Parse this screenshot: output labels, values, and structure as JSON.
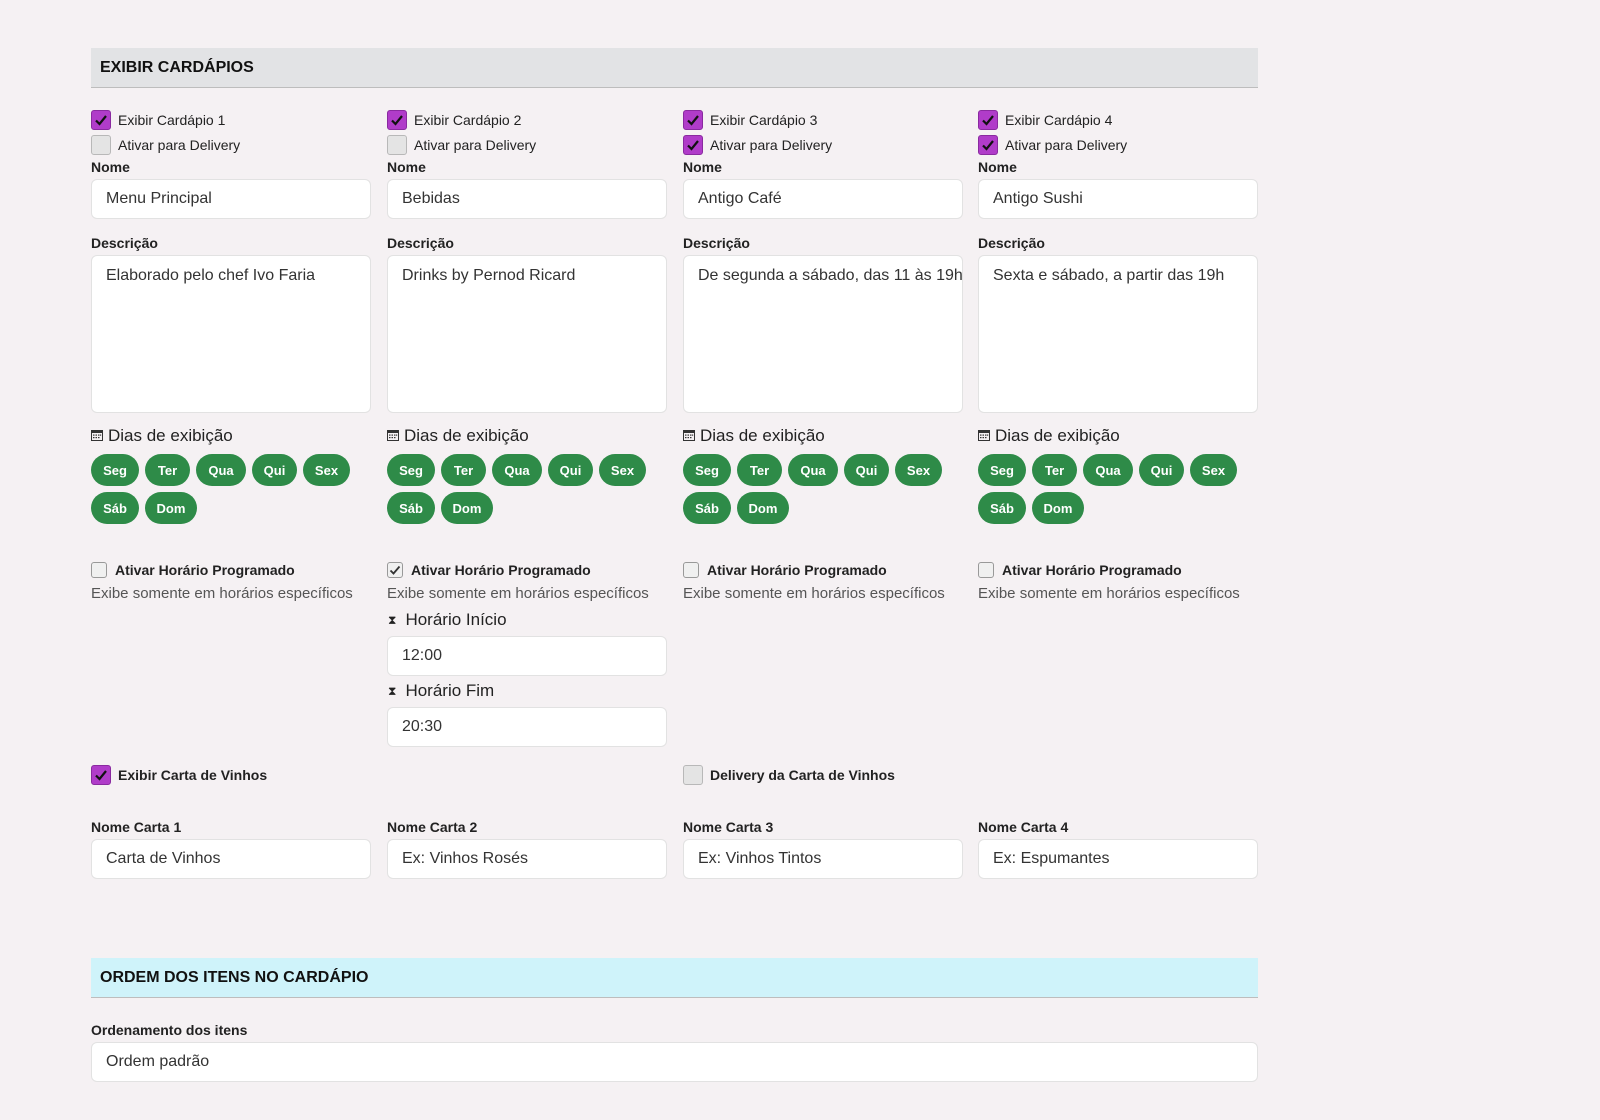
{
  "section_menus": {
    "title": "EXIBIR CARDÁPIOS"
  },
  "labels": {
    "nome": "Nome",
    "descricao": "Descrição",
    "dias": "Dias de exibição",
    "horario_programado": "Ativar Horário Programado",
    "horario_hint": "Exibe somente em horários específicos",
    "horario_inicio": "Horário Início",
    "horario_fim": "Horário Fim",
    "delivery": "Ativar para Delivery"
  },
  "days": [
    "Seg",
    "Ter",
    "Qua",
    "Qui",
    "Sex",
    "Sáb",
    "Dom"
  ],
  "menus": [
    {
      "show_label": "Exibir Cardápio 1",
      "show": true,
      "delivery": false,
      "name": "Menu Principal",
      "description": "Elaborado pelo chef Ivo Faria",
      "schedule": false
    },
    {
      "show_label": "Exibir Cardápio 2",
      "show": true,
      "delivery": false,
      "name": "Bebidas",
      "description": "Drinks by Pernod Ricard",
      "schedule": true,
      "start": "12:00",
      "end": "20:30"
    },
    {
      "show_label": "Exibir Cardápio 3",
      "show": true,
      "delivery": true,
      "name": "Antigo Café",
      "description": "De segunda a sábado, das 11 às 19h",
      "schedule": false
    },
    {
      "show_label": "Exibir Cardápio 4",
      "show": true,
      "delivery": true,
      "name": "Antigo Sushi",
      "description": "Sexta e sábado, a partir das 19h",
      "schedule": false
    }
  ],
  "wine": {
    "show_label": "Exibir Carta de Vinhos",
    "show": true,
    "delivery_label": "Delivery da Carta de Vinhos",
    "delivery": false,
    "cartas": [
      {
        "label": "Nome Carta 1",
        "value": "Carta de Vinhos",
        "placeholder": ""
      },
      {
        "label": "Nome Carta 2",
        "value": "",
        "placeholder": "Ex: Vinhos Rosés"
      },
      {
        "label": "Nome Carta 3",
        "value": "",
        "placeholder": "Ex: Vinhos Tintos"
      },
      {
        "label": "Nome Carta 4",
        "value": "",
        "placeholder": "Ex: Espumantes"
      }
    ]
  },
  "section_order": {
    "title": "ORDEM DOS ITENS NO CARDÁPIO"
  },
  "order": {
    "label": "Ordenamento dos itens",
    "value": "Ordem padrão"
  },
  "colors": {
    "accent_checkbox": "#b03cc9",
    "day_pill": "#2e8b48",
    "header_gray": "#e2e3e5",
    "header_cyan": "#cff3fa"
  }
}
